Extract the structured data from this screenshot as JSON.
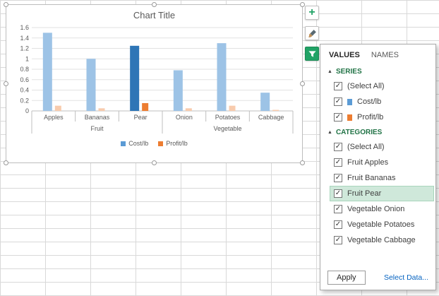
{
  "chart_data": {
    "type": "bar",
    "title": "Chart Title",
    "categories": [
      "Apples",
      "Bananas",
      "Pear",
      "Onion",
      "Potatoes",
      "Cabbage"
    ],
    "group_labels": [
      {
        "label": "Fruit",
        "span": 3
      },
      {
        "label": "Vegetable",
        "span": 3
      }
    ],
    "series": [
      {
        "name": "Cost/lb",
        "values": [
          1.5,
          1.0,
          1.25,
          0.78,
          1.3,
          0.35
        ],
        "bar_color": "#9dc3e6",
        "bar_highlight_color": "#2e75b6",
        "legend_color": "#5b9bd5"
      },
      {
        "name": "Profit/lb",
        "values": [
          0.1,
          0.05,
          0.15,
          0.05,
          0.1,
          0.02
        ],
        "bar_color": "#f8cbad",
        "bar_highlight_color": "#ed7d31",
        "legend_color": "#ed7d31"
      }
    ],
    "highlighted_category": "Pear",
    "ylim": [
      0,
      1.6
    ],
    "ytick_step": 0.2,
    "yticks": [
      "1.6",
      "1.4",
      "1.2",
      "1",
      "0.8",
      "0.6",
      "0.4",
      "0.2",
      "0"
    ],
    "grid": true,
    "legend_position": "bottom"
  },
  "chart_tools": {
    "elements_icon": "plus",
    "styles_icon": "paintbrush",
    "filters_icon": "funnel",
    "accent_green": "#21a366"
  },
  "filter_panel": {
    "tabs": [
      {
        "label": "VALUES",
        "active": true
      },
      {
        "label": "NAMES",
        "active": false
      }
    ],
    "series_section": {
      "title": "SERIES",
      "items": [
        {
          "label": "(Select All)",
          "checked": true
        },
        {
          "label": "Cost/lb",
          "checked": true,
          "color": "#5b9bd5"
        },
        {
          "label": "Profit/lb",
          "checked": true,
          "color": "#ed7d31"
        }
      ]
    },
    "categories_section": {
      "title": "CATEGORIES",
      "items": [
        {
          "label": "(Select All)",
          "checked": true
        },
        {
          "label": "Fruit Apples",
          "checked": true
        },
        {
          "label": "Fruit Bananas",
          "checked": true
        },
        {
          "label": "Fruit Pear",
          "checked": true,
          "highlighted": true
        },
        {
          "label": "Vegetable Onion",
          "checked": true
        },
        {
          "label": "Vegetable Potatoes",
          "checked": true
        },
        {
          "label": "Vegetable Cabbage",
          "checked": true
        }
      ]
    },
    "apply_label": "Apply",
    "select_data_label": "Select Data...",
    "accent_green": "#217346",
    "highlight_row_color": "#cfe8da",
    "link_color": "#0563c1"
  }
}
